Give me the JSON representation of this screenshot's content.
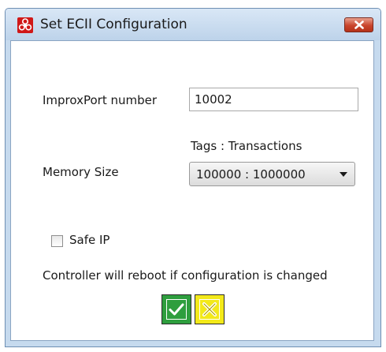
{
  "window": {
    "title": "Set ECII Configuration",
    "icon": "biohazard-icon",
    "close_icon": "close-icon"
  },
  "form": {
    "port_label": "ImproxPort number",
    "port_value": "10002",
    "tags_header": "Tags : Transactions",
    "memory_label": "Memory Size",
    "memory_value": "100000 : 1000000",
    "safe_ip_label": "Safe IP",
    "safe_ip_checked": false,
    "notice": "Controller will reboot if configuration is changed"
  },
  "buttons": {
    "ok_icon": "checkmark-icon",
    "cancel_icon": "cross-icon"
  },
  "colors": {
    "ok": "#2e9e3e",
    "cancel": "#f3e91a",
    "close": "#c9452c",
    "frame": "#c6daee"
  }
}
